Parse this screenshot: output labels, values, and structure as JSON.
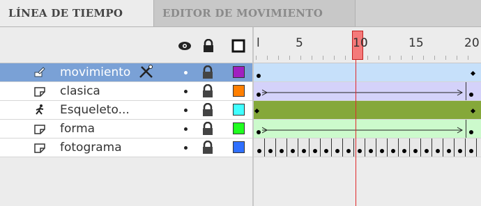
{
  "tabs": [
    {
      "label": "LÍNEA DE TIEMPO",
      "active": true
    },
    {
      "label": "EDITOR DE MOVIMIENTO",
      "active": false
    }
  ],
  "header_icons": [
    "eye-icon",
    "lock-icon",
    "outline-square-icon"
  ],
  "ruler": {
    "labels": [
      "l",
      "5",
      "10",
      "15",
      "20"
    ],
    "current_frame": "10"
  },
  "layers": [
    {
      "name": "movimiento",
      "icon": "motion-tween-icon",
      "selected": true,
      "color": "#a020c0",
      "extra_icon": "pen-cross-icon"
    },
    {
      "name": "clasica",
      "icon": "layer-icon",
      "selected": false,
      "color": "#ff7f00"
    },
    {
      "name": "Esqueleto...",
      "icon": "armature-icon",
      "selected": false,
      "color": "#40ffff"
    },
    {
      "name": "forma",
      "icon": "layer-icon",
      "selected": false,
      "color": "#20ff20"
    },
    {
      "name": "fotograma",
      "icon": "layer-icon",
      "selected": false,
      "color": "#3070ff"
    }
  ],
  "tracks": [
    {
      "layer": "movimiento",
      "type": "motion",
      "fill": "#c6e0fa"
    },
    {
      "layer": "clasica",
      "type": "classic",
      "fill": "#d4d2fa"
    },
    {
      "layer": "Esqueleto...",
      "type": "armature",
      "fill": "#85a83a"
    },
    {
      "layer": "forma",
      "type": "shape",
      "fill": "#ccfacc"
    },
    {
      "layer": "fotograma",
      "type": "keyframes",
      "fill": "#e8e8e8"
    }
  ]
}
